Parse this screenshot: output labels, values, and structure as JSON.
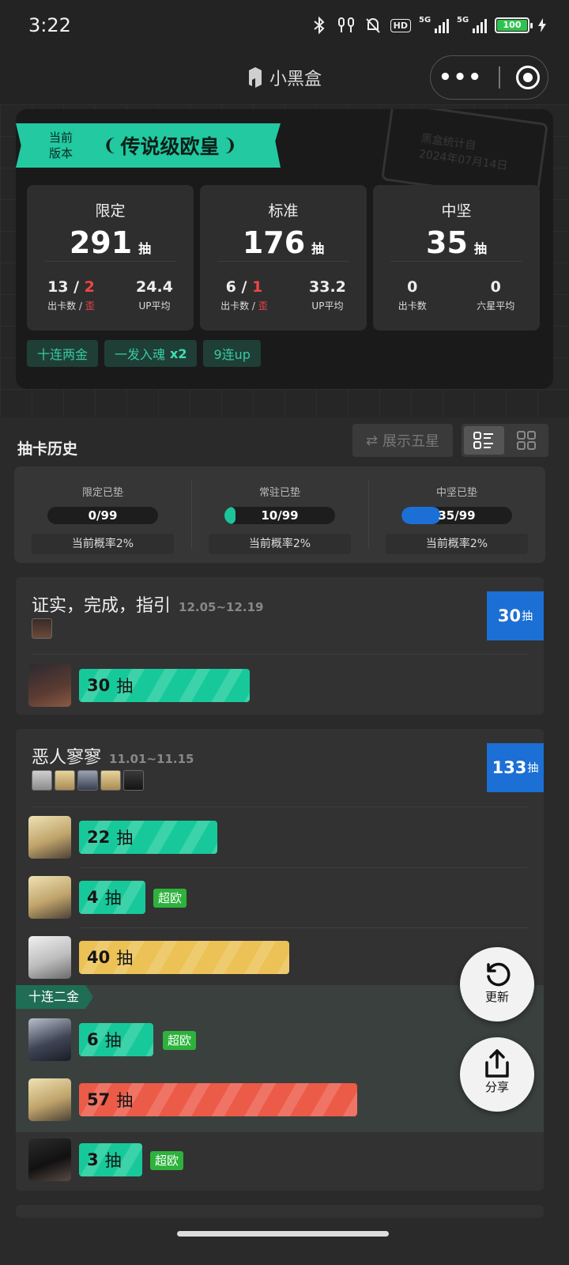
{
  "status": {
    "time": "3:22",
    "battery": "100",
    "net1": "5G",
    "net2": "5G",
    "hd": "HD"
  },
  "header": {
    "brand": "小黑盒",
    "more": "•••"
  },
  "summary": {
    "rank_label_line1": "当前",
    "rank_label_line2": "版本",
    "rank_title": "传说级欧皇",
    "stamp_line1": "黑盒统计自",
    "stamp_line2": "2024年07月14日",
    "stats": [
      {
        "name": "限定",
        "count": "291",
        "unit": "抽",
        "c1_a": "13 / ",
        "c1_b": "2",
        "c1_label_a": "出卡数 / ",
        "c1_label_b": "歪",
        "c2": "24.4",
        "c2_label": "UP平均"
      },
      {
        "name": "标准",
        "count": "176",
        "unit": "抽",
        "c1_a": "6 / ",
        "c1_b": "1",
        "c1_label_a": "出卡数 / ",
        "c1_label_b": "歪",
        "c2": "33.2",
        "c2_label": "UP平均"
      },
      {
        "name": "中坚",
        "count": "35",
        "unit": "抽",
        "c1_a": "0",
        "c1_b": "",
        "c1_label_a": "出卡数",
        "c1_label_b": "",
        "c2": "0",
        "c2_label": "六星平均"
      }
    ],
    "tags": [
      {
        "label": "十连两金",
        "extra": ""
      },
      {
        "label": "一发入魂",
        "extra": "x2"
      },
      {
        "label": "9连up",
        "extra": ""
      }
    ]
  },
  "history": {
    "title": "抽卡历史",
    "five_star_btn": "展示五星",
    "pity": [
      {
        "label": "限定已垫",
        "value": "0/99",
        "fraction": 0.0,
        "color": "#1dc49a",
        "rate": "当前概率2%"
      },
      {
        "label": "常驻已垫",
        "value": "10/99",
        "fraction": 0.101,
        "color": "#1dc49a",
        "rate": "当前概率2%"
      },
      {
        "label": "中坚已垫",
        "value": "35/99",
        "fraction": 0.354,
        "color": "#1c6fd4",
        "rate": "当前概率2%"
      }
    ],
    "pools": [
      {
        "name": "证实，完成，指引",
        "dates": "12.05~12.19",
        "total": "30",
        "unit": "抽",
        "pulls": [
          {
            "count": "30",
            "unit": "抽",
            "color": "green",
            "badge": ""
          }
        ]
      },
      {
        "name": "恶人寥寥",
        "dates": "11.01~11.15",
        "total": "133",
        "unit": "抽",
        "ten_tag": "十连二金",
        "pulls": [
          {
            "count": "22",
            "unit": "抽",
            "color": "green",
            "badge": ""
          },
          {
            "count": "4",
            "unit": "抽",
            "color": "green",
            "badge": "超欧"
          },
          {
            "count": "40",
            "unit": "抽",
            "color": "yellow",
            "badge": ""
          },
          {
            "count": "6",
            "unit": "抽",
            "color": "green",
            "badge": "超欧"
          },
          {
            "count": "57",
            "unit": "抽",
            "color": "red",
            "badge": ""
          },
          {
            "count": "3",
            "unit": "抽",
            "color": "green",
            "badge": "超欧"
          }
        ]
      }
    ]
  },
  "fab": {
    "refresh": "更新",
    "share": "分享"
  }
}
